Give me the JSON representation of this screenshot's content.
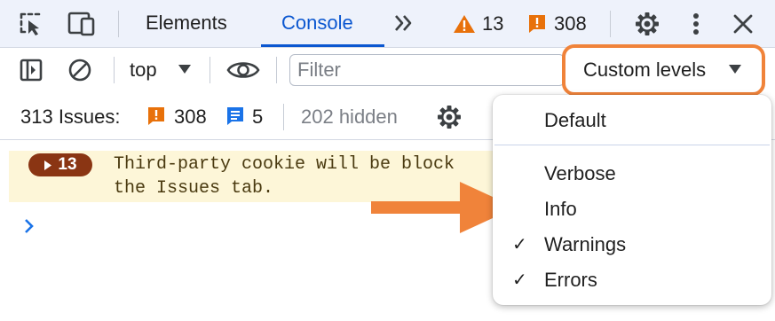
{
  "toolbar": {
    "tabs": [
      {
        "label": "Elements",
        "active": false
      },
      {
        "label": "Console",
        "active": true
      }
    ],
    "more_tabs_icon": "double-chevron-icon",
    "warnings_count": "13",
    "errors_count": "308"
  },
  "console_bar": {
    "context_label": "top",
    "filter_placeholder": "Filter",
    "filter_value": "",
    "levels_label": "Custom levels"
  },
  "issues_bar": {
    "issues_label": "313 Issues:",
    "error_issues": "308",
    "info_issues": "5",
    "hidden_label": "202 hidden"
  },
  "message": {
    "count": "13",
    "line1": "Third-party cookie will be block",
    "line2": "the Issues tab."
  },
  "levels_menu": {
    "items": [
      {
        "label": "Default",
        "checked": false
      },
      {
        "label": "Verbose",
        "checked": false
      },
      {
        "label": "Info",
        "checked": false
      },
      {
        "label": "Warnings",
        "checked": true
      },
      {
        "label": "Errors",
        "checked": true
      }
    ],
    "check_glyph": "✓"
  },
  "colors": {
    "accent_blue": "#0b57d0",
    "warning_orange": "#e8710a",
    "error_orange": "#e8710a",
    "annotation_orange": "#f0833a",
    "message_bg": "#fdf6d8"
  }
}
